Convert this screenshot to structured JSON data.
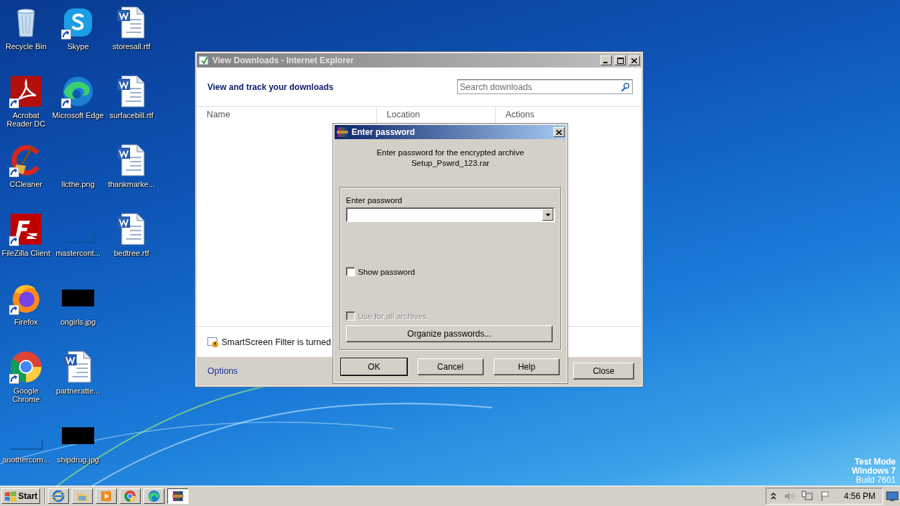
{
  "desktop": {
    "columns": [
      [
        {
          "label": "Recycle Bin",
          "kind": "recycle-bin",
          "shortcut": false
        },
        {
          "label": "Acrobat\nReader DC",
          "kind": "pdf",
          "shortcut": true
        },
        {
          "label": "CCleaner",
          "kind": "broom",
          "shortcut": true
        },
        {
          "label": "FileZilla Client",
          "kind": "ftp",
          "shortcut": true
        },
        {
          "label": "Firefox",
          "kind": "firefox",
          "shortcut": true
        },
        {
          "label": "Google\nChrome",
          "kind": "chrome",
          "shortcut": true
        },
        {
          "label": "anothercom...",
          "kind": "blank-image",
          "shortcut": false
        }
      ],
      [
        {
          "label": "Skype",
          "kind": "chat",
          "shortcut": true
        },
        {
          "label": "Microsoft Edge",
          "kind": "edge",
          "shortcut": true
        },
        {
          "label": "llcthe.png",
          "kind": "blank-image",
          "shortcut": false
        },
        {
          "label": "mastercont...",
          "kind": "blank-image",
          "shortcut": false
        },
        {
          "label": "ongirls.jpg",
          "kind": "black-image",
          "shortcut": false
        },
        {
          "label": "partneratte...",
          "kind": "document",
          "shortcut": false
        },
        {
          "label": "shipdrug.jpg",
          "kind": "black-image",
          "shortcut": false
        }
      ],
      [
        {
          "label": "storesall.rtf",
          "kind": "document",
          "shortcut": false
        },
        {
          "label": "surfacebill.rtf",
          "kind": "document",
          "shortcut": false
        },
        {
          "label": "thankmarke...",
          "kind": "document",
          "shortcut": false
        },
        {
          "label": "bedtree.rtf",
          "kind": "document",
          "shortcut": false
        }
      ]
    ]
  },
  "downloads_window": {
    "title": "View Downloads - Internet Explorer",
    "active": false,
    "heading": "View and track your downloads",
    "search": {
      "placeholder": "Search downloads"
    },
    "columns": [
      "Name",
      "Location",
      "Actions"
    ],
    "smartscreen": "SmartScreen Filter is turned",
    "options_link": "Options",
    "close_button": "Close"
  },
  "password_dialog": {
    "title": "Enter password",
    "active": true,
    "message_lines": [
      "Enter password for the encrypted archive",
      "Setup_Pswrd_123.rar"
    ],
    "field_label": "Enter password",
    "checkboxes": [
      {
        "label": "Show password",
        "checked": false,
        "disabled": false
      },
      {
        "label": "Use for all archives",
        "checked": false,
        "disabled": true
      }
    ],
    "organize_button": "Organize passwords...",
    "buttons": [
      {
        "label": "OK",
        "default": true
      },
      {
        "label": "Cancel",
        "default": false
      },
      {
        "label": "Help",
        "default": false
      }
    ]
  },
  "system_notice": {
    "lines": [
      "Test Mode",
      "Windows 7",
      "Build 7601"
    ]
  },
  "taskbar": {
    "start": "Start",
    "apps": [
      {
        "kind": "ie",
        "active": false
      },
      {
        "kind": "folder",
        "active": false
      },
      {
        "kind": "media",
        "active": false
      },
      {
        "kind": "chrome",
        "active": false
      },
      {
        "kind": "edge",
        "active": false
      },
      {
        "kind": "archive",
        "active": true
      }
    ],
    "clock": "4:56 PM"
  }
}
